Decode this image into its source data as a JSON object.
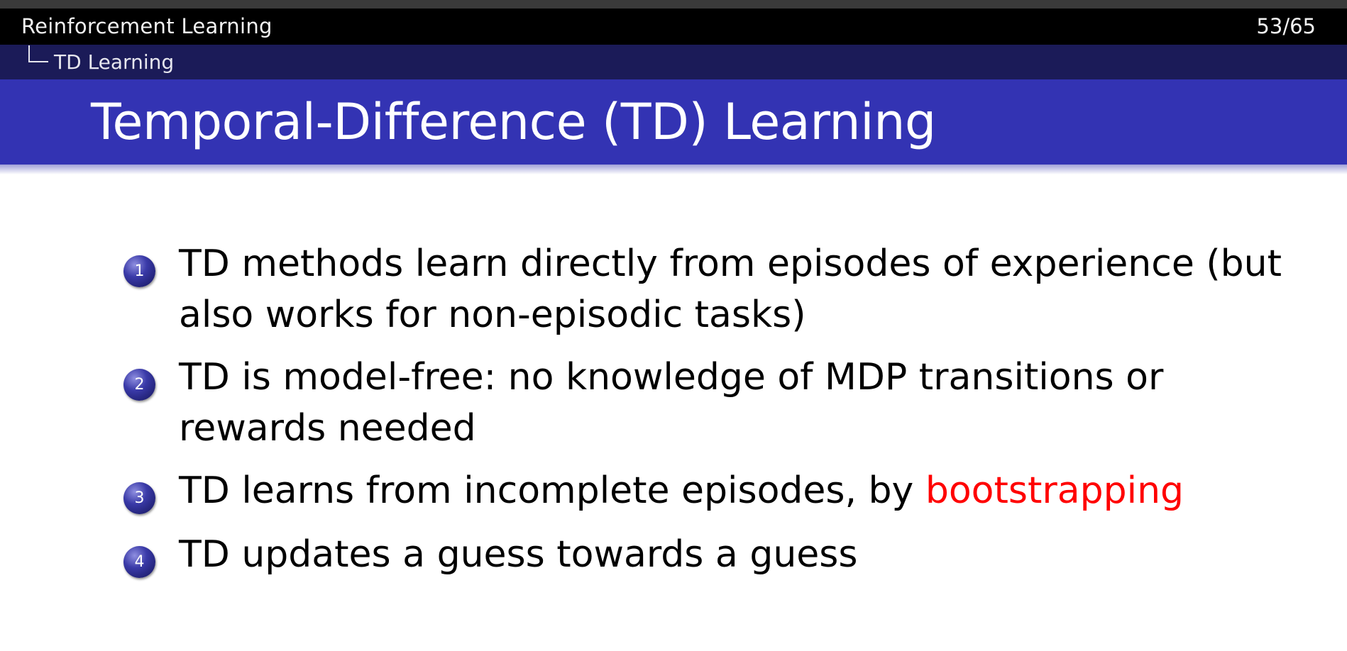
{
  "header": {
    "course_title": "Reinforcement Learning",
    "page_counter": "53/65",
    "section_title": "TD Learning"
  },
  "frame": {
    "title": "Temporal-Difference (TD) Learning"
  },
  "items": [
    {
      "number": "1",
      "line1": "TD methods learn directly from episodes of experience (but",
      "line2": "also works for non-episodic tasks)"
    },
    {
      "number": "2",
      "line1": "TD is model-free: no knowledge of MDP transitions or",
      "line2": "rewards needed"
    },
    {
      "number": "3",
      "text": "TD learns from incomplete episodes, by ",
      "highlight": "bootstrapping"
    },
    {
      "number": "4",
      "text": "TD updates a guess towards a guess"
    }
  ],
  "colors": {
    "title_bar": "#3333b3",
    "section_bar": "#1b1b58",
    "headline_bar": "#000000",
    "alert": "#ff0000"
  }
}
